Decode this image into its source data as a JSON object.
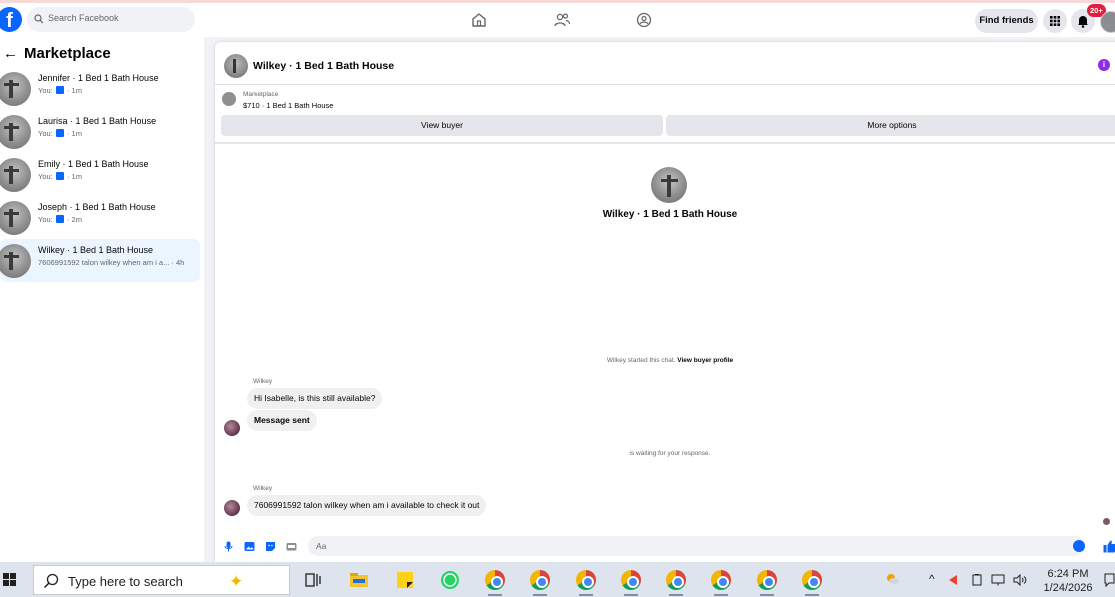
{
  "topbar": {
    "logo_letter": "f",
    "search_placeholder": "Search Facebook",
    "find_friends_label": "Find friends",
    "notification_badge": "20+"
  },
  "sidebar": {
    "back_arrow": "←",
    "title": "Marketplace",
    "conversations": [
      {
        "title": "Jennifer · 1 Bed 1 Bath House",
        "prefix": "You:",
        "time": "· 1m",
        "active": false
      },
      {
        "title": "Laurisa · 1 Bed 1 Bath House",
        "prefix": "You:",
        "time": "· 1m",
        "active": false
      },
      {
        "title": "Emily · 1 Bed 1 Bath House",
        "prefix": "You:",
        "time": "· 1m",
        "active": false
      },
      {
        "title": "Joseph · 1 Bed 1 Bath House",
        "prefix": "You:",
        "time": "· 2m",
        "active": false
      },
      {
        "title": "Wilkey · 1 Bed 1 Bath House",
        "preview": "7606991592 talon wilkey when am i a... · 4h",
        "active": true
      }
    ]
  },
  "chat": {
    "title": "Wilkey · 1 Bed 1 Bath House",
    "info_icon": "i",
    "listing_label": "Marketplace",
    "listing_info": "$710 · 1 Bed 1 Bath House",
    "view_buyer_label": "View buyer",
    "more_options_label": "More options",
    "center_name": "Wilkey · 1 Bed 1 Bath House",
    "started_note": "Wilkey started this chat.",
    "view_profile_link": "View buyer profile",
    "waiting_note": "is waiting for your response.",
    "messages": [
      {
        "sender": "Wilkey",
        "text": "Hi Isabelle, is this still available?"
      },
      {
        "sender": "",
        "text": "Message sent"
      },
      {
        "sender": "Wilkey",
        "text": "7606991592 talon wilkey when am i available to check it out"
      }
    ],
    "composer_placeholder": "Aa"
  },
  "taskbar": {
    "search_placeholder": "Type here to search",
    "time": "6:24 PM",
    "date": "1/24/2026",
    "tray_arrow": "^"
  },
  "colors": {
    "facebook_blue": "#0866ff",
    "badge_red": "#e41e3f",
    "active_conversation": "#ebf5ff",
    "info_purple": "#8b2ee6"
  }
}
